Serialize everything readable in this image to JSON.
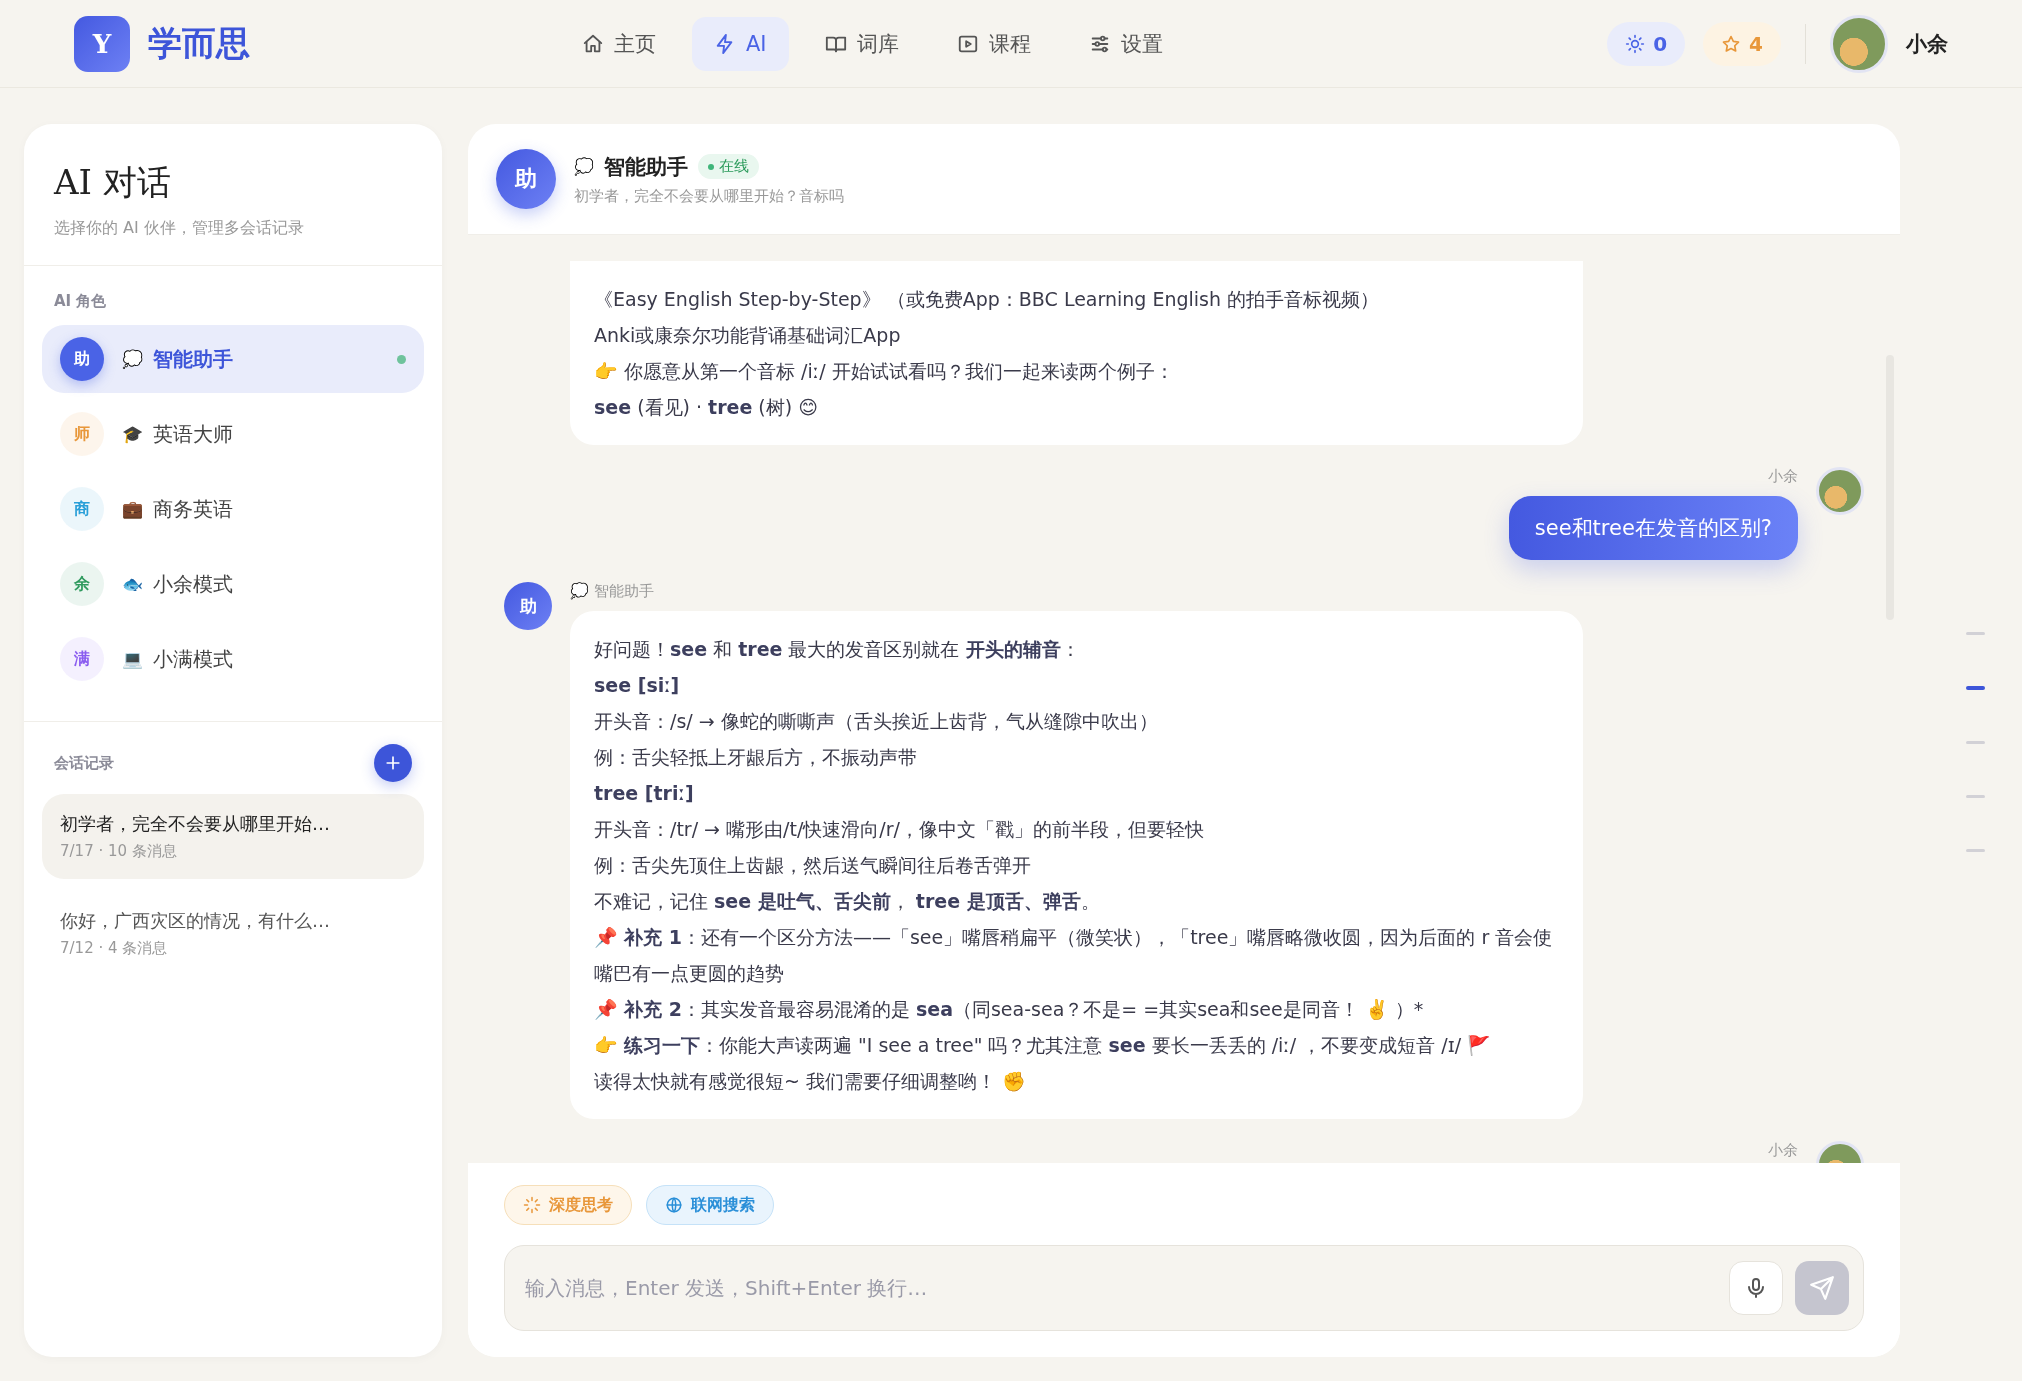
{
  "brand": {
    "logo_letter": "Y",
    "name": "学而思"
  },
  "nav": [
    {
      "kind": "home",
      "label": "主页",
      "selected": false
    },
    {
      "kind": "bolt",
      "label": "AI",
      "selected": true
    },
    {
      "kind": "book",
      "label": "词库",
      "selected": false
    },
    {
      "kind": "play",
      "label": "课程",
      "selected": false
    },
    {
      "kind": "sliders",
      "label": "设置",
      "selected": false
    }
  ],
  "stats": [
    {
      "kind": "sun",
      "value": "0"
    },
    {
      "kind": "star",
      "value": "4"
    }
  ],
  "user": {
    "name": "小余"
  },
  "sidebar": {
    "title": "AI 对话",
    "subtitle": "选择你的 AI 伙伴，管理多会话记录",
    "roles_label": "AI 角色",
    "roles": [
      {
        "avatar": "助",
        "emoji": "💭",
        "name": "智能助手",
        "color": "#4a63e6",
        "selected": true,
        "online": true
      },
      {
        "avatar": "师",
        "emoji": "🎓",
        "name": "英语大师",
        "color": "#e8973a",
        "selected": false,
        "online": false
      },
      {
        "avatar": "商",
        "emoji": "💼",
        "name": "商务英语",
        "color": "#2a9fd8",
        "selected": false,
        "online": false
      },
      {
        "avatar": "余",
        "emoji": "🐟",
        "name": "小余模式",
        "color": "#2f9a5e",
        "selected": false,
        "online": false
      },
      {
        "avatar": "满",
        "emoji": "💻",
        "name": "小满模式",
        "color": "#8a5cf0",
        "selected": false,
        "online": false
      }
    ],
    "sessions_label": "会话记录",
    "sessions": [
      {
        "title": "初学者，完全不会要从哪里开始…",
        "meta": "7/17 · 10 条消息",
        "selected": true
      },
      {
        "title": "你好，广西灾区的情况，有什么…",
        "meta": "7/12 · 4 条消息",
        "selected": false
      }
    ]
  },
  "chat": {
    "avatar": "助",
    "emoji": "💭",
    "name": "智能助手",
    "status": "在线",
    "subtitle": "初学者，完全不会要从哪里开始？音标吗",
    "messages": [
      {
        "kind": "assistant",
        "lines": [
          "《Easy English Step-by-Step》 （或免费App：BBC Learning English 的拍手音标视频）",
          "Anki或康奈尔功能背诵基础词汇App",
          "👉 你愿意从第一个音标 /iː/ 开始试试看吗？我们一起来读两个例子：",
          "**see** (看见) · **tree** (树) 😊"
        ]
      },
      {
        "kind": "user",
        "sender": "小余",
        "lines": [
          "see和tree在发音的区别?"
        ]
      },
      {
        "kind": "assistant",
        "avatar": "助",
        "sender_emoji": "💭",
        "sender": "智能助手",
        "lines": [
          "好问题！**see** 和 **tree** 最大的发音区别就在 **开头的辅音**：",
          "**see [siː]**",
          "开头音：/s/ → 像蛇的嘶嘶声（舌头挨近上齿背，气从缝隙中吹出）",
          "例：舌尖轻抵上牙龈后方，不振动声带",
          "**tree [triː]**",
          "开头音：/tr/ → 嘴形由/t/快速滑向/r/，像中文「戳」的前半段，但要轻快",
          "例：舌尖先顶住上齿龈，然后送气瞬间往后卷舌弹开",
          "不难记，记住 **see 是吐气、舌尖前**， **tree 是顶舌、弹舌**。",
          "📌 **补充 1**：还有一个区分方法——「see」嘴唇稍扁平（微笑状），「tree」嘴唇略微收圆，因为后面的 r 音会使嘴巴有一点更圆的趋势",
          "📌 **补充 2**：其实发音最容易混淆的是 **sea**（同sea-sea？不是= =其实sea和see是同音！ ✌️ ）*",
          "👉 **练习一下**：你能大声读两遍 \"I see a tree\" 吗？尤其注意 **see** 要长一丢丢的 /iː/ ，不要变成短音 /ɪ/ 🚩",
          "读得太快就有感觉很短~ 我们需要仔细调整哟！ ✊"
        ]
      },
      {
        "kind": "user",
        "sender": "小余"
      }
    ],
    "tools": [
      {
        "kind": "think",
        "label": "深度思考"
      },
      {
        "kind": "search",
        "label": "联网搜索"
      }
    ],
    "input": {
      "placeholder": "输入消息，Enter 发送，Shift+Enter 换行…"
    }
  },
  "outline": [
    {
      "selected": false
    },
    {
      "selected": true
    },
    {
      "selected": false
    },
    {
      "selected": false
    },
    {
      "selected": false
    }
  ]
}
